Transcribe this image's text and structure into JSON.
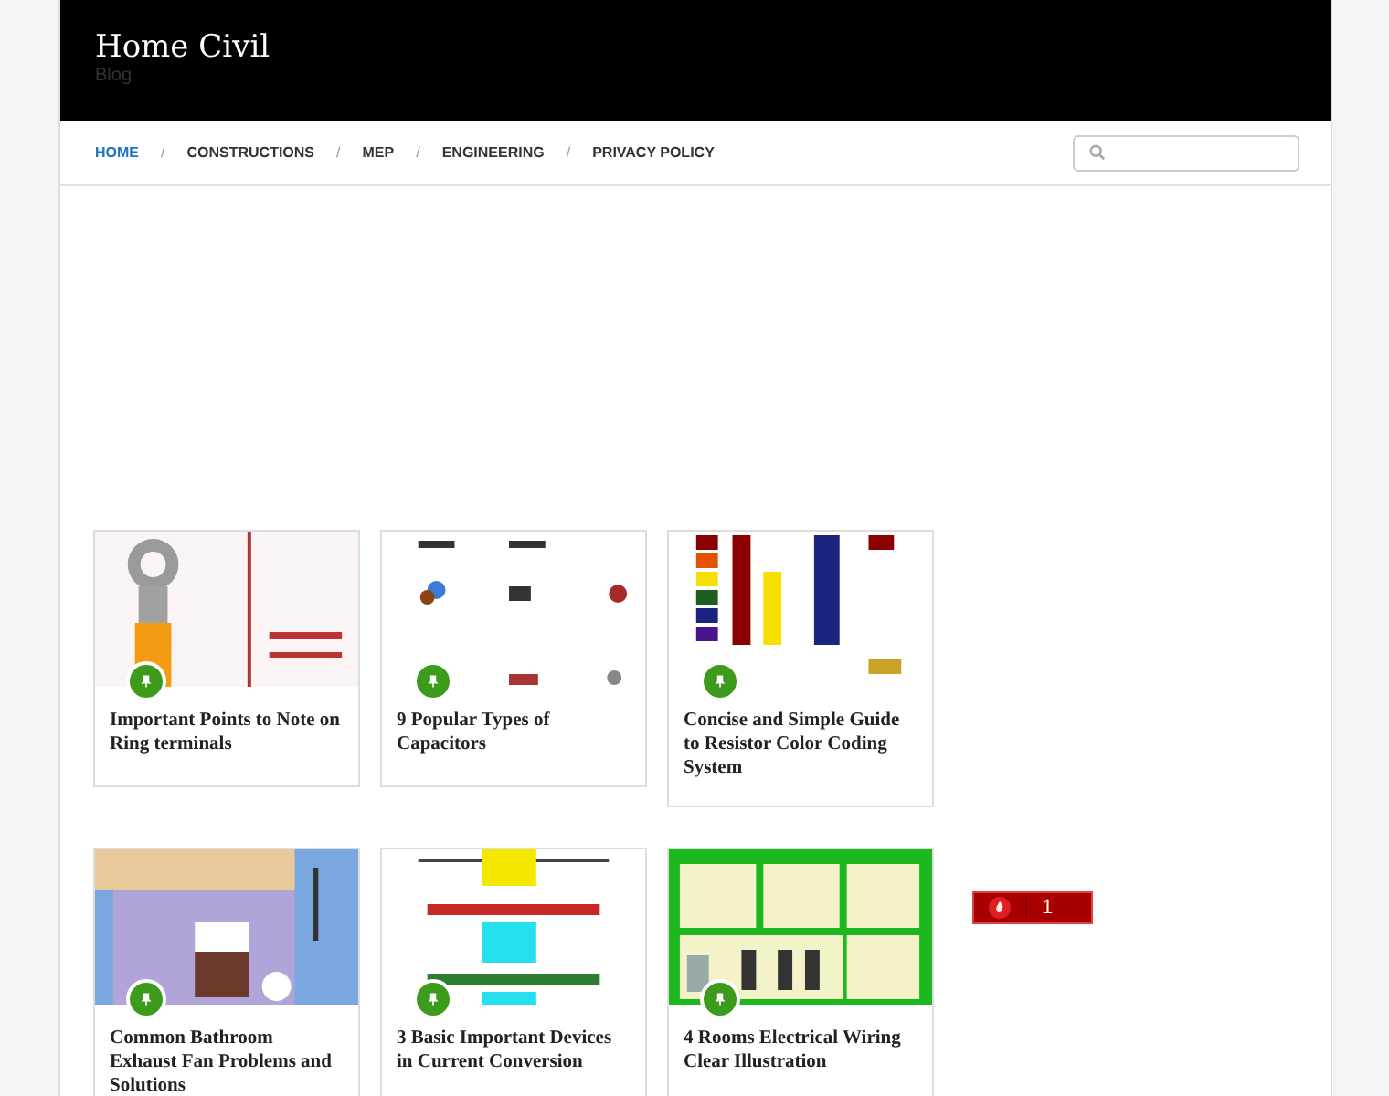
{
  "site": {
    "title": "Home Civil",
    "tagline": "Blog"
  },
  "nav": [
    {
      "label": "HOME",
      "selected": true
    },
    {
      "separator": "/",
      "label": "CONSTRUCTIONS",
      "selected": false
    },
    {
      "separator": "/",
      "label": "MEP",
      "selected": false
    },
    {
      "separator": "/",
      "label": "ENGINEERING",
      "selected": false
    },
    {
      "separator": "/",
      "label": "PRIVACY POLICY",
      "selected": false
    }
  ],
  "posts": [
    {
      "title": "Important Points to Note on Ring terminals"
    },
    {
      "title": "9 Popular Types of Capacitors"
    },
    {
      "title": "Concise and Simple Guide to Resistor Color Coding System"
    },
    {
      "title": "Common Bathroom Exhaust Fan Problems and Solutions"
    },
    {
      "title": "3 Basic Important Devices in Current Conversion"
    },
    {
      "title": "4 Rooms Electrical Wiring Clear Illustration"
    }
  ],
  "widget": {
    "count": "1"
  }
}
